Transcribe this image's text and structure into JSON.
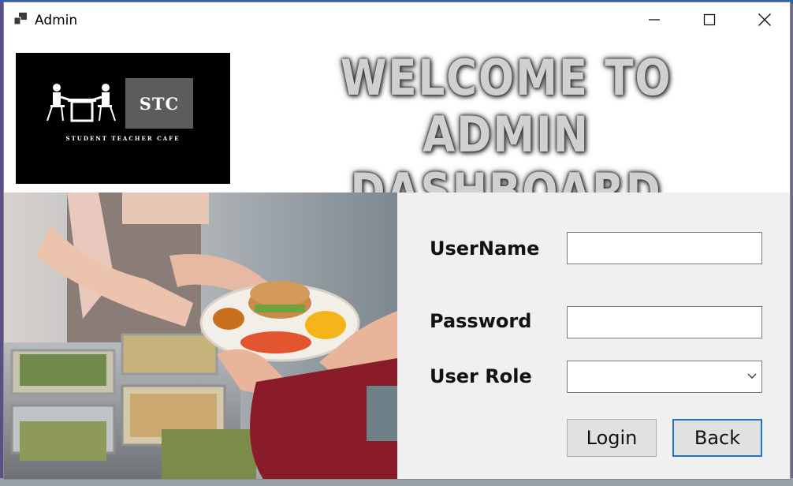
{
  "window": {
    "title": "Admin"
  },
  "header": {
    "logo_mark": "STC",
    "logo_caption": "STUDENT TEACHER CAFE",
    "welcome_line1": "WELCOME TO ADMIN",
    "welcome_line2": "DASHBOARD"
  },
  "form": {
    "username_label": "UserName",
    "username_value": "",
    "password_label": "Password",
    "password_value": "",
    "role_label": "User Role",
    "role_selected": "",
    "login_label": "Login",
    "back_label": "Back"
  },
  "icons": {
    "app": "window-app-icon",
    "minimize": "minimize-icon",
    "maximize": "maximize-icon",
    "close": "close-icon",
    "dropdown": "chevron-down-icon"
  },
  "colors": {
    "focus_border": "#1f73d2",
    "panel_bg": "#f0f0f0",
    "button_bg": "#e1e1e1"
  }
}
